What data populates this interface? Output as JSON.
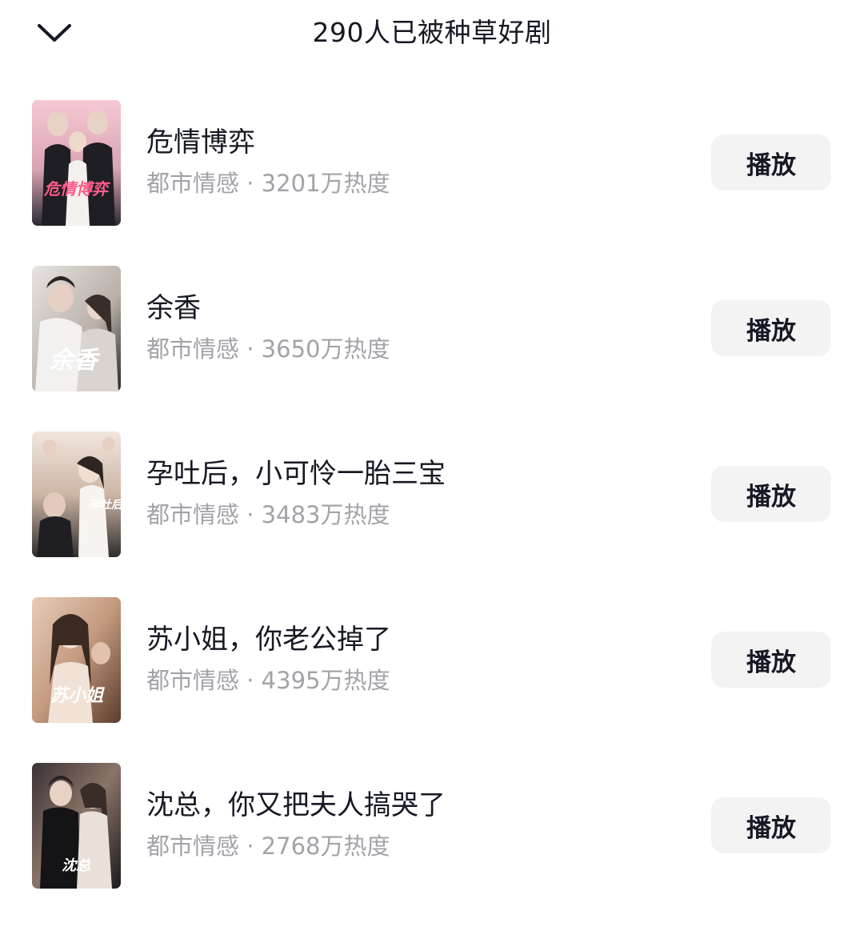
{
  "header": {
    "back_icon": "chevron-down-icon",
    "title": "290人已被种草好剧"
  },
  "items": [
    {
      "title": "危情博弈",
      "genre": "都市情感",
      "separator": "·",
      "heat": "3201万热度",
      "play_label": "播放",
      "poster_text": "危情博弈",
      "poster_colors": [
        "#f3c6d0",
        "#2a2a34"
      ]
    },
    {
      "title": "余香",
      "genre": "都市情感",
      "separator": "·",
      "heat": "3650万热度",
      "play_label": "播放",
      "poster_text": "余香",
      "poster_colors": [
        "#e9e6e4",
        "#3a3430"
      ]
    },
    {
      "title": "孕吐后，小可怜一胎三宝",
      "genre": "都市情感",
      "separator": "·",
      "heat": "3483万热度",
      "play_label": "播放",
      "poster_text": "孕吐后",
      "poster_colors": [
        "#efe0d6",
        "#3d3a36"
      ]
    },
    {
      "title": "苏小姐，你老公掉了",
      "genre": "都市情感",
      "separator": "·",
      "heat": "4395万热度",
      "play_label": "播放",
      "poster_text": "苏小姐",
      "poster_colors": [
        "#d9b9a0",
        "#5a4032"
      ]
    },
    {
      "title": "沈总，你又把夫人搞哭了",
      "genre": "都市情感",
      "separator": "·",
      "heat": "2768万热度",
      "play_label": "播放",
      "poster_text": "沈总",
      "poster_colors": [
        "#2a2628",
        "#b59b88"
      ]
    }
  ]
}
